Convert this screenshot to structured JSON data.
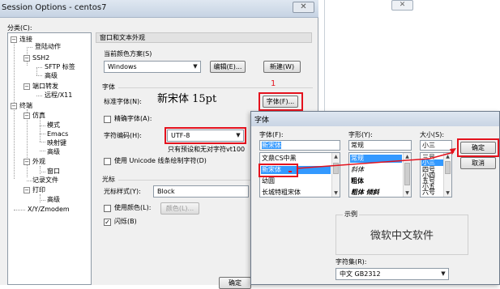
{
  "main_window": {
    "title": "Session Options - centos7",
    "close_glyph": "✕",
    "category_label": "分类(C):",
    "tree": [
      {
        "label": "连接",
        "toggle": "−"
      },
      {
        "label": "登陆动作",
        "toggle": ""
      },
      {
        "label": "SSH2",
        "toggle": "−"
      },
      {
        "label": "SFTP 标签",
        "toggle": ""
      },
      {
        "label": "高级",
        "toggle": ""
      },
      {
        "label": "端口转发",
        "toggle": "−"
      },
      {
        "label": "远程/X11",
        "toggle": ""
      },
      {
        "label": "终端",
        "toggle": "−"
      },
      {
        "label": "仿真",
        "toggle": "−"
      },
      {
        "label": "模式",
        "toggle": ""
      },
      {
        "label": "Emacs",
        "toggle": ""
      },
      {
        "label": "映射键",
        "toggle": ""
      },
      {
        "label": "高级",
        "toggle": ""
      },
      {
        "label": "外观",
        "toggle": "−"
      },
      {
        "label": "窗口",
        "toggle": ""
      },
      {
        "label": "记录文件",
        "toggle": ""
      },
      {
        "label": "打印",
        "toggle": "−"
      },
      {
        "label": "高级",
        "toggle": ""
      },
      {
        "label": "X/Y/Zmodem",
        "toggle": ""
      }
    ],
    "section_title": "窗口和文本外观",
    "color_scheme_label": "当前颜色方案(S)",
    "color_scheme_value": "Windows",
    "edit_button": "编辑(E)...",
    "new_button": "新建(W)",
    "font_group_label": "字体",
    "normal_font_label": "标准字体(N):",
    "normal_font_value": "新宋体 15pt",
    "font_button": "字体(F)...",
    "annotation_number": "1",
    "exact_font_label": "精确字体(A):",
    "encoding_label": "字符编码(H):",
    "encoding_value": "UTF-8",
    "encoding_note": "只有预设和无对字符vt100",
    "unicode_label": "使用 Unicode 线条绘制字符(D)",
    "cursor_group_label": "光标",
    "cursor_style_label": "光标样式(Y):",
    "cursor_style_value": "Block",
    "use_color_label": "使用颜色(L):",
    "color_button": "颜色(L)...",
    "blink_label": "闪烁(B)",
    "blink_checked": "✓",
    "ok_button_partial": "确定"
  },
  "font_dialog": {
    "title": "字体",
    "font_label": "字体(F):",
    "font_value": "新宋体",
    "font_list": [
      "文鼎CS中黑",
      "新宋体",
      "幼圆",
      "长城特粗宋体"
    ],
    "style_label": "字形(Y):",
    "style_value": "常规",
    "style_list": [
      "常规",
      "斜体",
      "粗体",
      "粗体 倾斜"
    ],
    "size_label": "大小(S):",
    "size_value": "小三",
    "size_list": [
      "三号",
      "小三",
      "四号",
      "小四",
      "五号",
      "小五",
      "六号",
      "小六"
    ],
    "ok_button": "确定",
    "cancel_button": "取消",
    "sample_label": "示例",
    "sample_text": "微软中文软件",
    "charset_label": "字符集(R):",
    "charset_value": "中文 GB2312"
  },
  "icons": {
    "dropdown": "▼",
    "scroll_up": "▲",
    "scroll_down": "▼"
  },
  "colors": {
    "annotation_red": "#e4121d",
    "selection_blue": "#3399ff"
  }
}
